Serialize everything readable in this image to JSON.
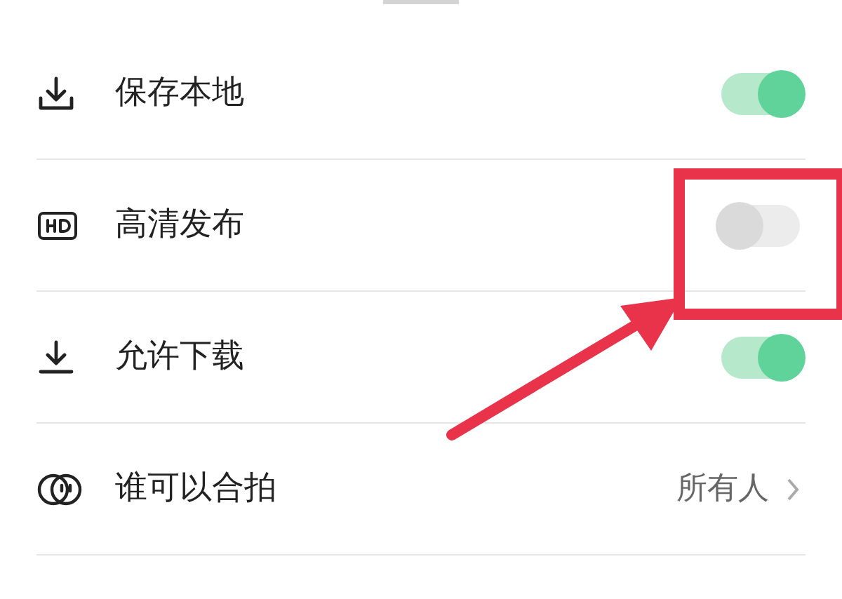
{
  "settings": [
    {
      "kind": "toggle",
      "label": "保存本地",
      "on": true
    },
    {
      "kind": "toggle",
      "label": "高清发布",
      "on": false
    },
    {
      "kind": "toggle",
      "label": "允许下载",
      "on": true
    },
    {
      "kind": "link",
      "label": "谁可以合拍",
      "value": "所有人"
    }
  ]
}
